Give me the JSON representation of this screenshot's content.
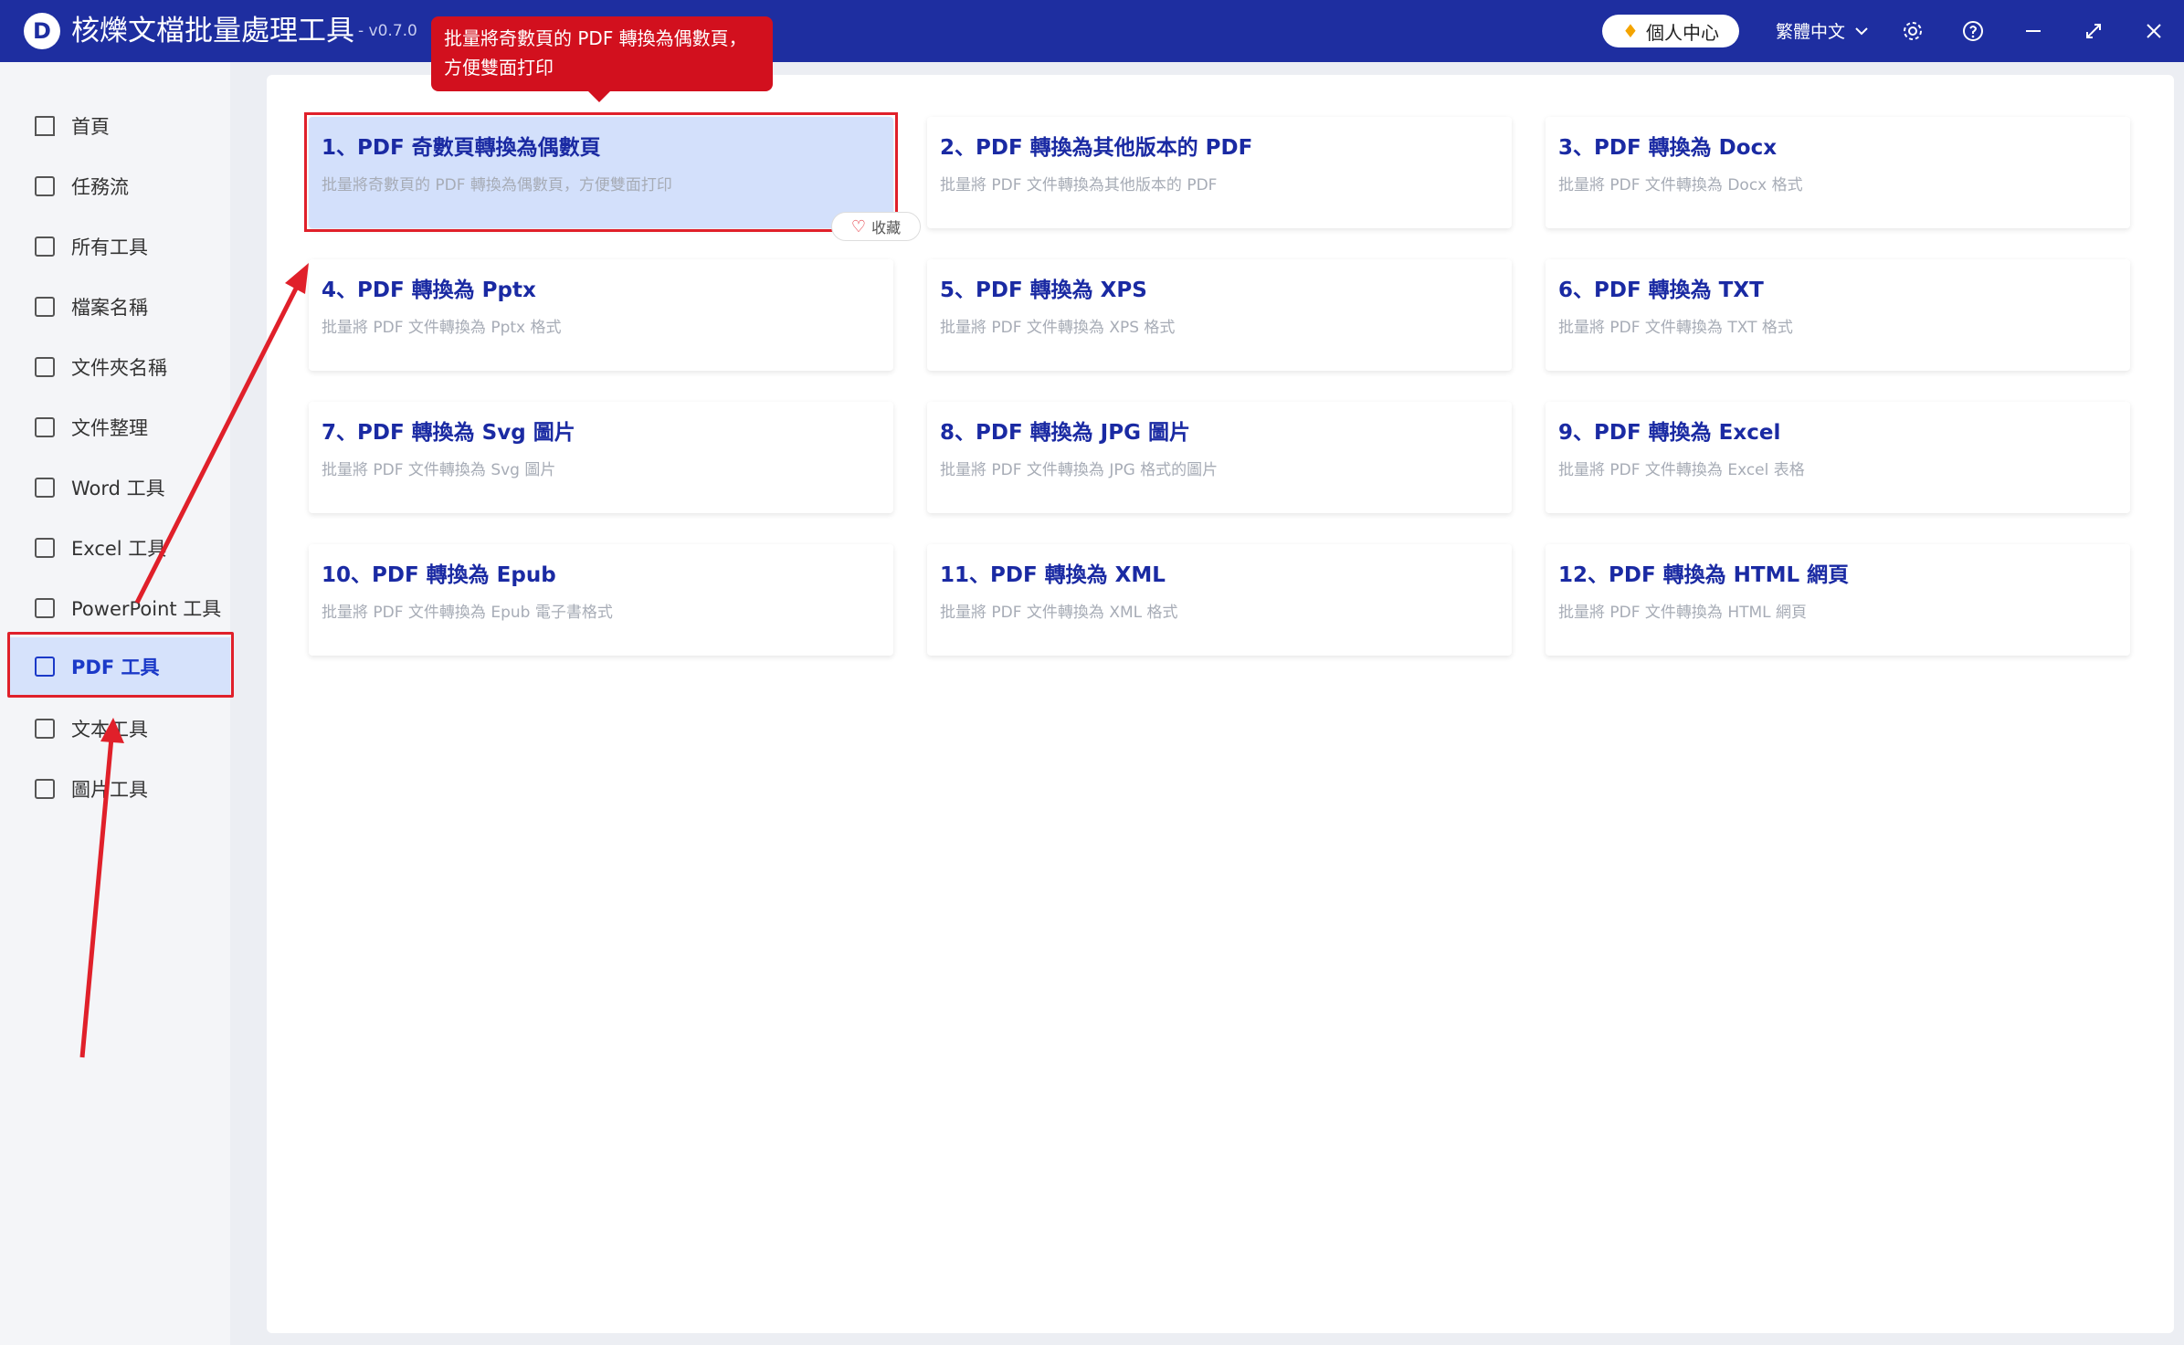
{
  "app": {
    "logo_letter": "D",
    "title": "核爍文檔批量處理工具",
    "version": "- v0.7.0",
    "profile_label": "個人中心",
    "language": "繁體中文"
  },
  "titlebar_icons": [
    "gear-icon",
    "help-icon",
    "minimize-icon",
    "maximize-icon",
    "close-icon"
  ],
  "sidebar": {
    "items": [
      {
        "label": "首頁",
        "icon": "home-icon"
      },
      {
        "label": "任務流",
        "icon": "workflow-icon"
      },
      {
        "label": "所有工具",
        "icon": "monitor-icon"
      },
      {
        "label": "檔案名稱",
        "icon": "file-icon"
      },
      {
        "label": "文件夾名稱",
        "icon": "folder-icon"
      },
      {
        "label": "文件整理",
        "icon": "organize-icon"
      },
      {
        "label": "Word 工具",
        "icon": "word-icon"
      },
      {
        "label": "Excel 工具",
        "icon": "excel-icon"
      },
      {
        "label": "PowerPoint 工具",
        "icon": "powerpoint-icon"
      },
      {
        "label": "PDF 工具",
        "icon": "pdf-icon"
      },
      {
        "label": "文本工具",
        "icon": "text-icon"
      },
      {
        "label": "圖片工具",
        "icon": "image-icon"
      }
    ],
    "active_index": 9
  },
  "tooltip": {
    "line1": "批量將奇數頁的 PDF 轉換為偶數頁，",
    "line2": "方便雙面打印"
  },
  "favorite_label": "收藏",
  "cards": [
    {
      "title": "1、PDF 奇數頁轉換為偶數頁",
      "desc": "批量將奇數頁的 PDF 轉換為偶數頁，方便雙面打印"
    },
    {
      "title": "2、PDF 轉換為其他版本的 PDF",
      "desc": "批量將 PDF 文件轉換為其他版本的 PDF"
    },
    {
      "title": "3、PDF 轉換為 Docx",
      "desc": "批量將 PDF 文件轉換為 Docx 格式"
    },
    {
      "title": "4、PDF 轉換為 Pptx",
      "desc": "批量將 PDF 文件轉換為 Pptx 格式"
    },
    {
      "title": "5、PDF 轉換為 XPS",
      "desc": "批量將 PDF 文件轉換為 XPS 格式"
    },
    {
      "title": "6、PDF 轉換為 TXT",
      "desc": "批量將 PDF 文件轉換為 TXT 格式"
    },
    {
      "title": "7、PDF 轉換為 Svg 圖片",
      "desc": "批量將 PDF 文件轉換為 Svg 圖片"
    },
    {
      "title": "8、PDF 轉換為 JPG 圖片",
      "desc": "批量將 PDF 文件轉換為 JPG 格式的圖片"
    },
    {
      "title": "9、PDF 轉換為 Excel",
      "desc": "批量將 PDF 文件轉換為 Excel 表格"
    },
    {
      "title": "10、PDF 轉換為 Epub",
      "desc": "批量將 PDF 文件轉換為 Epub 電子書格式"
    },
    {
      "title": "11、PDF 轉換為 XML",
      "desc": "批量將 PDF 文件轉換為 XML 格式"
    },
    {
      "title": "12、PDF 轉換為 HTML 網頁",
      "desc": "批量將 PDF 文件轉換為 HTML 網頁"
    }
  ],
  "colors": {
    "titlebar": "#1e2ea0",
    "accent": "#1a2aa3",
    "highlight": "#e0202a",
    "selected_card": "#d3e0fb"
  }
}
